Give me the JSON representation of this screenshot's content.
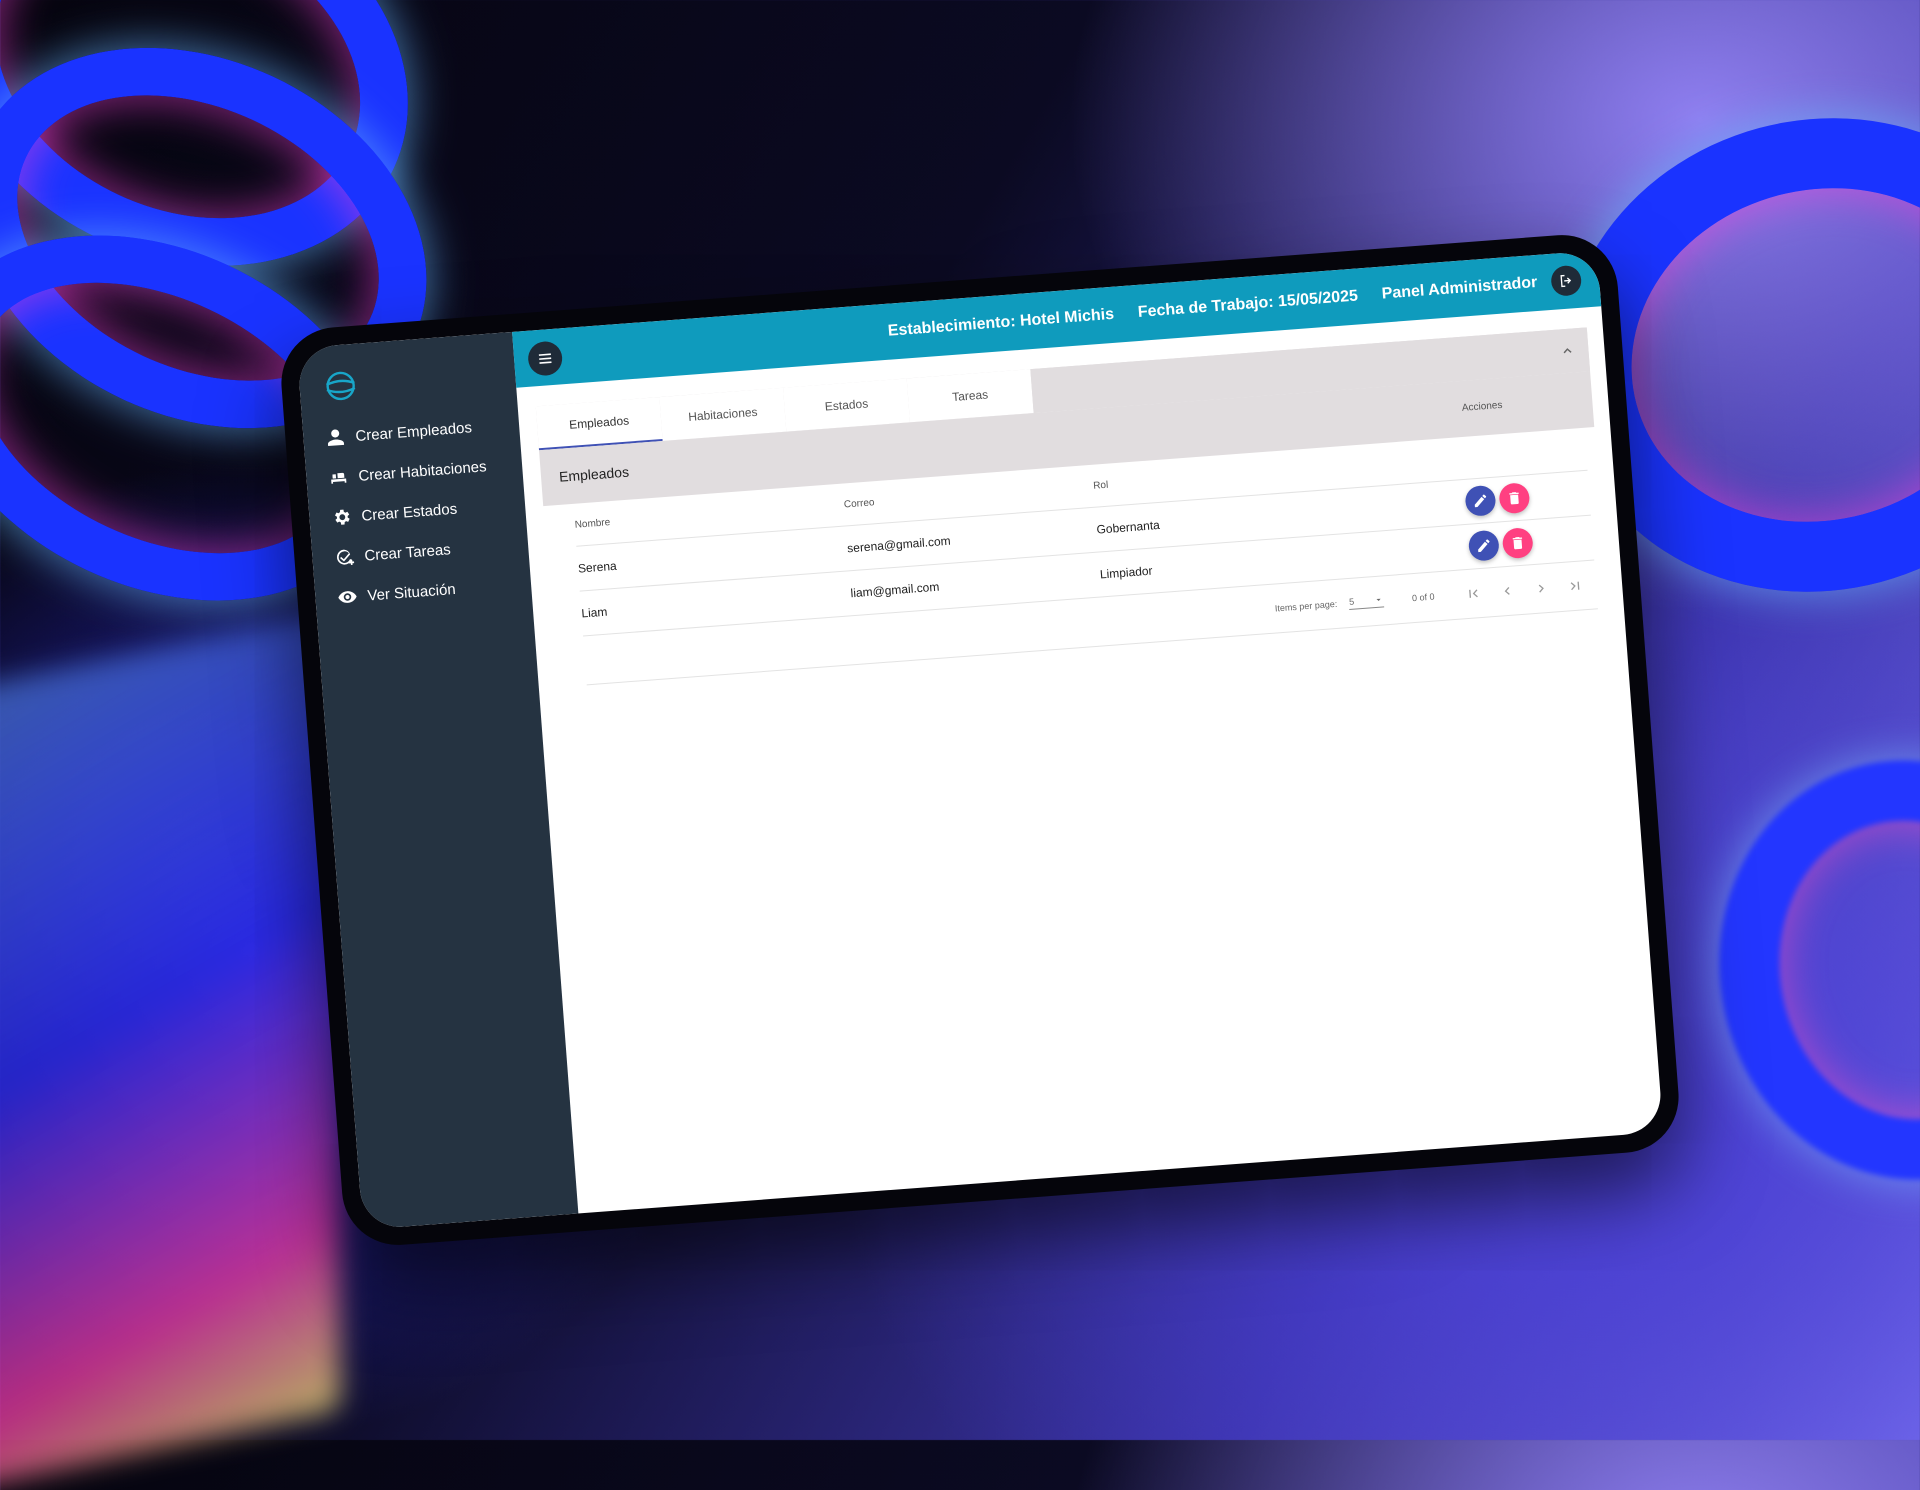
{
  "header": {
    "establishment": "Establecimiento: Hotel Michis",
    "work_date": "Fecha de Trabajo: 15/05/2025",
    "panel": "Panel Administrador"
  },
  "sidebar": {
    "items": [
      {
        "label": "Crear Empleados",
        "icon": "person-icon"
      },
      {
        "label": "Crear Habitaciones",
        "icon": "bed-icon"
      },
      {
        "label": "Crear Estados",
        "icon": "gear-icon"
      },
      {
        "label": "Crear Tareas",
        "icon": "task-add-icon"
      },
      {
        "label": "Ver Situación",
        "icon": "eye-icon"
      }
    ]
  },
  "tabs": [
    "Empleados",
    "Habitaciones",
    "Estados",
    "Tareas"
  ],
  "active_tab": "Empleados",
  "panel": {
    "title": "Empleados",
    "actions_header": "Acciones",
    "columns": [
      "Nombre",
      "Correo",
      "Rol"
    ],
    "rows": [
      {
        "nombre": "Serena",
        "correo": "serena@gmail.com",
        "rol": "Gobernanta"
      },
      {
        "nombre": "Liam",
        "correo": "liam@gmail.com",
        "rol": "Limpiador"
      }
    ]
  },
  "paginator": {
    "items_per_page_label": "Items per page:",
    "page_size": "5",
    "range": "0 of 0"
  },
  "colors": {
    "topbar": "#0f9bbd",
    "sidebar": "#253341",
    "edit_button": "#3f51b5",
    "delete_button": "#ff4081",
    "panel_header": "#e1dddf"
  }
}
